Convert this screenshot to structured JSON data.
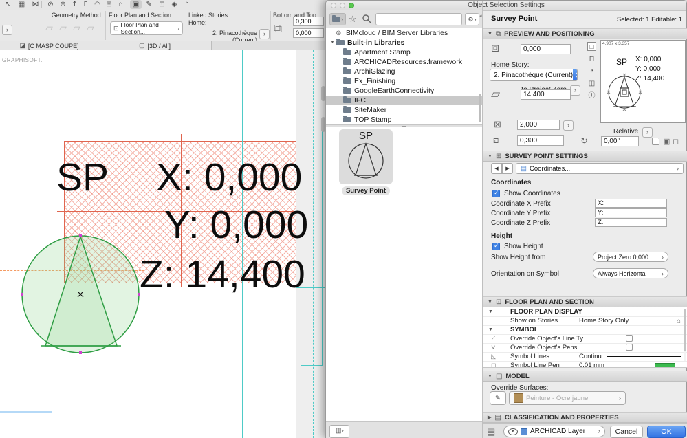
{
  "window": {
    "title": "Object Selection Settings"
  },
  "toolbar": {
    "icons": [
      {
        "name": "pointer-tool-icon",
        "glyph": "↖"
      },
      {
        "name": "grid-tool-icon",
        "glyph": "▦"
      },
      {
        "name": "stretch-tool-icon",
        "glyph": "⋈"
      },
      {
        "name": "split-tool-icon",
        "glyph": "⊘"
      },
      {
        "name": "pick-up-parameters-icon",
        "glyph": "⊕"
      },
      {
        "name": "elevation-tool-icon",
        "glyph": "↥"
      },
      {
        "name": "corner-tool-icon",
        "glyph": "Γ"
      },
      {
        "name": "fillet-tool-icon",
        "glyph": "◠"
      },
      {
        "name": "detail-tool-icon",
        "glyph": "⊞"
      },
      {
        "name": "home-view-icon",
        "glyph": "⌂"
      },
      {
        "name": "marquee-tool-icon",
        "glyph": "▣",
        "selected": true
      },
      {
        "name": "pencil-tool-icon",
        "glyph": "✎"
      },
      {
        "name": "copy-settings-icon",
        "glyph": "⊡"
      },
      {
        "name": "morph-tool-icon",
        "glyph": "◈"
      },
      {
        "name": "toolbar-more-icon",
        "glyph": "ˇ"
      }
    ]
  },
  "infobar": {
    "expander_glyph": "›",
    "geometry_method_label": "Geometry Method:",
    "geometry_icons": [
      "▱",
      "▱",
      "▱",
      "▱"
    ],
    "floor_plan_section_label": "Floor Plan and Section:",
    "floor_plan_button_label": "Floor Plan and Section...",
    "floor_plan_button_chevron": "›",
    "linked_stories_label": "Linked Stories:",
    "home_label": "Home:",
    "home_story_value": "2. Pinacothèque (Current)",
    "bottom_top_label": "Bottom and Top:",
    "top_value": "0,300",
    "bottom_value": "0,000"
  },
  "tabs": {
    "section_tab": "[C MASP COUPE]",
    "threed_tab": "[3D / All]"
  },
  "canvas": {
    "brand": "GRAPHISOFT.",
    "sp_label": "SP",
    "x_label": "X: 0,000",
    "y_label": "Y: 0,000",
    "z_label": "Z: 14,400"
  },
  "dialog": {
    "tree": {
      "items": [
        {
          "label": "BIMcloud / BIM Server Libraries",
          "selected": false
        },
        {
          "label": "Built-in Libraries",
          "selected": false,
          "expanded": true
        },
        {
          "label": "Apartment Stamp",
          "selected": false
        },
        {
          "label": "ARCHICADResources.framework",
          "selected": false
        },
        {
          "label": "ArchiGlazing",
          "selected": false
        },
        {
          "label": "Ex_Finishing",
          "selected": false
        },
        {
          "label": "GoogleEarthConnectivity",
          "selected": false
        },
        {
          "label": "IFC",
          "selected": true
        },
        {
          "label": "SiteMaker",
          "selected": false
        },
        {
          "label": "TOP Stamp",
          "selected": false
        }
      ]
    },
    "thumbnail": {
      "sp": "SP",
      "caption": "Survey Point"
    },
    "header": {
      "object_name": "Survey Point",
      "selection_status": "Selected: 1 Editable: 1"
    },
    "preview": {
      "section_title": "PREVIEW AND POSITIONING",
      "offset_top_value": "0,000",
      "home_story_label": "Home Story:",
      "home_story_value": "2. Pinacothèque (Current)",
      "anchor_label": "to Project Zero",
      "anchor_chevron": "›",
      "elevation_value": "14,400",
      "width_value": "2,000",
      "height_value": "0,300",
      "preview_size": "4,907 x 3,357",
      "preview_sp": "SP",
      "preview_x": "X: 0,000",
      "preview_y": "Y: 0,000",
      "preview_z": "Z: 14,400",
      "relative_label": "Relative",
      "rotation_value": "0,00°"
    },
    "survey": {
      "section_title": "SURVEY POINT SETTINGS",
      "page_value": "Coordinates...",
      "coordinates_heading": "Coordinates",
      "show_coordinates_label": "Show Coordinates",
      "show_coordinates_checked": true,
      "x_prefix_label": "Coordinate X Prefix",
      "x_prefix_value": "X:",
      "y_prefix_label": "Coordinate Y Prefix",
      "y_prefix_value": "Y:",
      "z_prefix_label": "Coordinate Z Prefix",
      "z_prefix_value": "Z:",
      "height_heading": "Height",
      "show_height_label": "Show Height",
      "show_height_checked": true,
      "show_height_from_label": "Show Height from",
      "show_height_from_value": "Project Zero 0,000",
      "orientation_label": "Orientation on Symbol",
      "orientation_value": "Always Horizontal"
    },
    "floorplan": {
      "section_title": "FLOOR PLAN AND SECTION",
      "rows": [
        {
          "label": "FLOOR PLAN DISPLAY"
        },
        {
          "label": "Show on Stories",
          "value": "Home Story Only"
        },
        {
          "label": "SYMBOL"
        },
        {
          "label": "Override Object's Line Ty...",
          "checked": false,
          "icon_glyph": "⟋"
        },
        {
          "label": "Override Object's Pens",
          "checked": false,
          "icon_glyph": "⋎"
        },
        {
          "label": "Symbol Lines",
          "value": "Continu",
          "icon_glyph": "◺"
        },
        {
          "label": "Symbol Line Pen",
          "value": "0.01 mm",
          "icon_glyph": "◻"
        }
      ]
    },
    "model": {
      "section_title": "MODEL",
      "override_surfaces_label": "Override Surfaces:",
      "surface_value": "Peinture - Ocre jaune"
    },
    "classification": {
      "section_title": "CLASSIFICATION AND PROPERTIES"
    },
    "footer": {
      "layer_value": "ARCHICAD Layer",
      "cancel_label": "Cancel",
      "ok_label": "OK"
    }
  },
  "colors": {
    "accent_blue": "#3e82e4",
    "ok_blue": "#3272e2",
    "selection_green": "#2f9e44",
    "hatch_red": "#e8705a",
    "guide_orange": "#f49a62",
    "marker_cyan": "#4ecbc7",
    "hotspot_magenta": "#cf3fcf",
    "pen_green": "#3bbb4e",
    "surface_swatch": "#b28e55"
  }
}
